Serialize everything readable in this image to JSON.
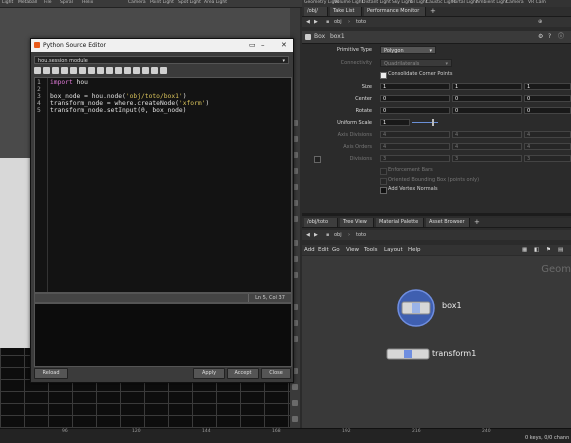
{
  "shelf": {
    "items": [
      "Light",
      "Metaball",
      "File",
      "Spiral",
      "Helix"
    ],
    "right_items": [
      "Camera",
      "Point Light",
      "Spot Light",
      "Area Light",
      "Geometry Light",
      "Volume Light",
      "Distant Light",
      "Sky Light",
      "GI Light",
      "Caustic Light",
      "Portal Light",
      "Ambient Light",
      "Camera",
      "VR Cam"
    ]
  },
  "pane_tabs_top": [
    "/obj/",
    "Take List",
    "Performance Monitor"
  ],
  "python_editor": {
    "title": "Python Source Editor",
    "module": "hou.session module",
    "lines": [
      "1",
      "2",
      "3",
      "4",
      "5"
    ],
    "code": {
      "l1_kw": "import",
      "l1_rest": " hou",
      "l3_a": "box_node = hou.node(",
      "l3_str": "'obj/toto/box1'",
      "l3_b": ")",
      "l4_a": "transform_node = where.createNode(",
      "l4_str": "'xform'",
      "l4_b": ")",
      "l5": "transform_node.setInput(0, box_node)"
    },
    "cursor_pos": "Ln 5, Col 37",
    "buttons": {
      "reload": "Reload",
      "apply": "Apply",
      "accept": "Accept",
      "close": "Close"
    }
  },
  "params": {
    "path_obj": "obj",
    "path_node": "toto",
    "node_type": "Box",
    "node_name": "box1",
    "primitive_type_label": "Primitive Type",
    "primitive_type_value": "Polygon",
    "connectivity_label": "Connectivity",
    "connectivity_value": "Quadrilaterals",
    "consolidate_label": "Consolidate Corner Points",
    "size_label": "Size",
    "size": [
      "1",
      "1",
      "1"
    ],
    "center_label": "Center",
    "center": [
      "0",
      "0",
      "0"
    ],
    "rotate_label": "Rotate",
    "rotate": [
      "0",
      "0",
      "0"
    ],
    "uniform_scale_label": "Uniform Scale",
    "uniform_scale": "1",
    "axis_divisions_label": "Axis Divisions",
    "axis_divisions": [
      "4",
      "4",
      "4"
    ],
    "axis_orders_label": "Axis Orders",
    "axis_orders": [
      "4",
      "4",
      "4"
    ],
    "divisions_label": "Divisions",
    "divisions": [
      "3",
      "3",
      "3"
    ],
    "enforcement_bars_label": "Enforcement Bars",
    "oriented_bbox_label": "Oriented Bounding Box (points only)",
    "add_vertex_normals_label": "Add Vertex Normals"
  },
  "net_tabs": [
    "/obj/toto",
    "Tree View",
    "Material Palette",
    "Asset Browser"
  ],
  "net": {
    "path_obj": "obj",
    "path_node": "toto",
    "menu": [
      "Add",
      "Edit",
      "Go",
      "View",
      "Tools",
      "Layout",
      "Help"
    ],
    "context_label": "Geom",
    "nodes": [
      {
        "name": "box1"
      },
      {
        "name": "transform1"
      }
    ]
  },
  "timeline": {
    "ticks": [
      "96",
      "120",
      "144",
      "168",
      "192",
      "216",
      "240"
    ],
    "keys": "0 keys, 0/0 chann"
  },
  "colors": {
    "accent": "#e85a1a",
    "node_selected": "#5a7bd6",
    "node_body": "#d7d7d7"
  }
}
